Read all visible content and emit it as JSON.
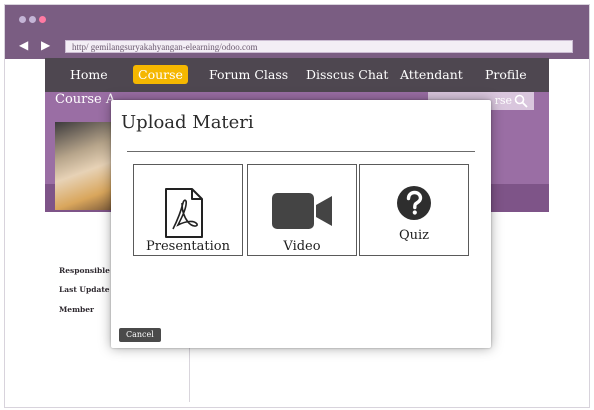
{
  "browser": {
    "url": "http/ gemilangsuryakahyangan-elearning/odoo.com",
    "back_icon": "chevron-left-icon",
    "forward_icon": "chevron-right-icon"
  },
  "nav": {
    "items": [
      {
        "label": "Home"
      },
      {
        "label": "Course",
        "active": true
      },
      {
        "label": "Forum Class"
      },
      {
        "label": "Disscus Chat"
      },
      {
        "label": "Attendant"
      },
      {
        "label": "Profile"
      }
    ],
    "active_color": "#f5b700"
  },
  "banner": {
    "title": "Course A",
    "search_text": "rse"
  },
  "meta": {
    "responsible": "Responsible",
    "last_update": "Last Update",
    "member": "Member"
  },
  "modal": {
    "title": "Upload Materi",
    "options": [
      {
        "label": "Presentation",
        "icon": "pdf-file-icon"
      },
      {
        "label": "Video",
        "icon": "video-camera-icon"
      },
      {
        "label": "Quiz",
        "icon": "question-mark-icon"
      }
    ],
    "cancel_label": "Cancel"
  },
  "colors": {
    "chrome": "#7a5d82",
    "nav_bar": "#4e4750",
    "banner": "#9a6ea4",
    "cancel_button": "#4a4a4a"
  }
}
